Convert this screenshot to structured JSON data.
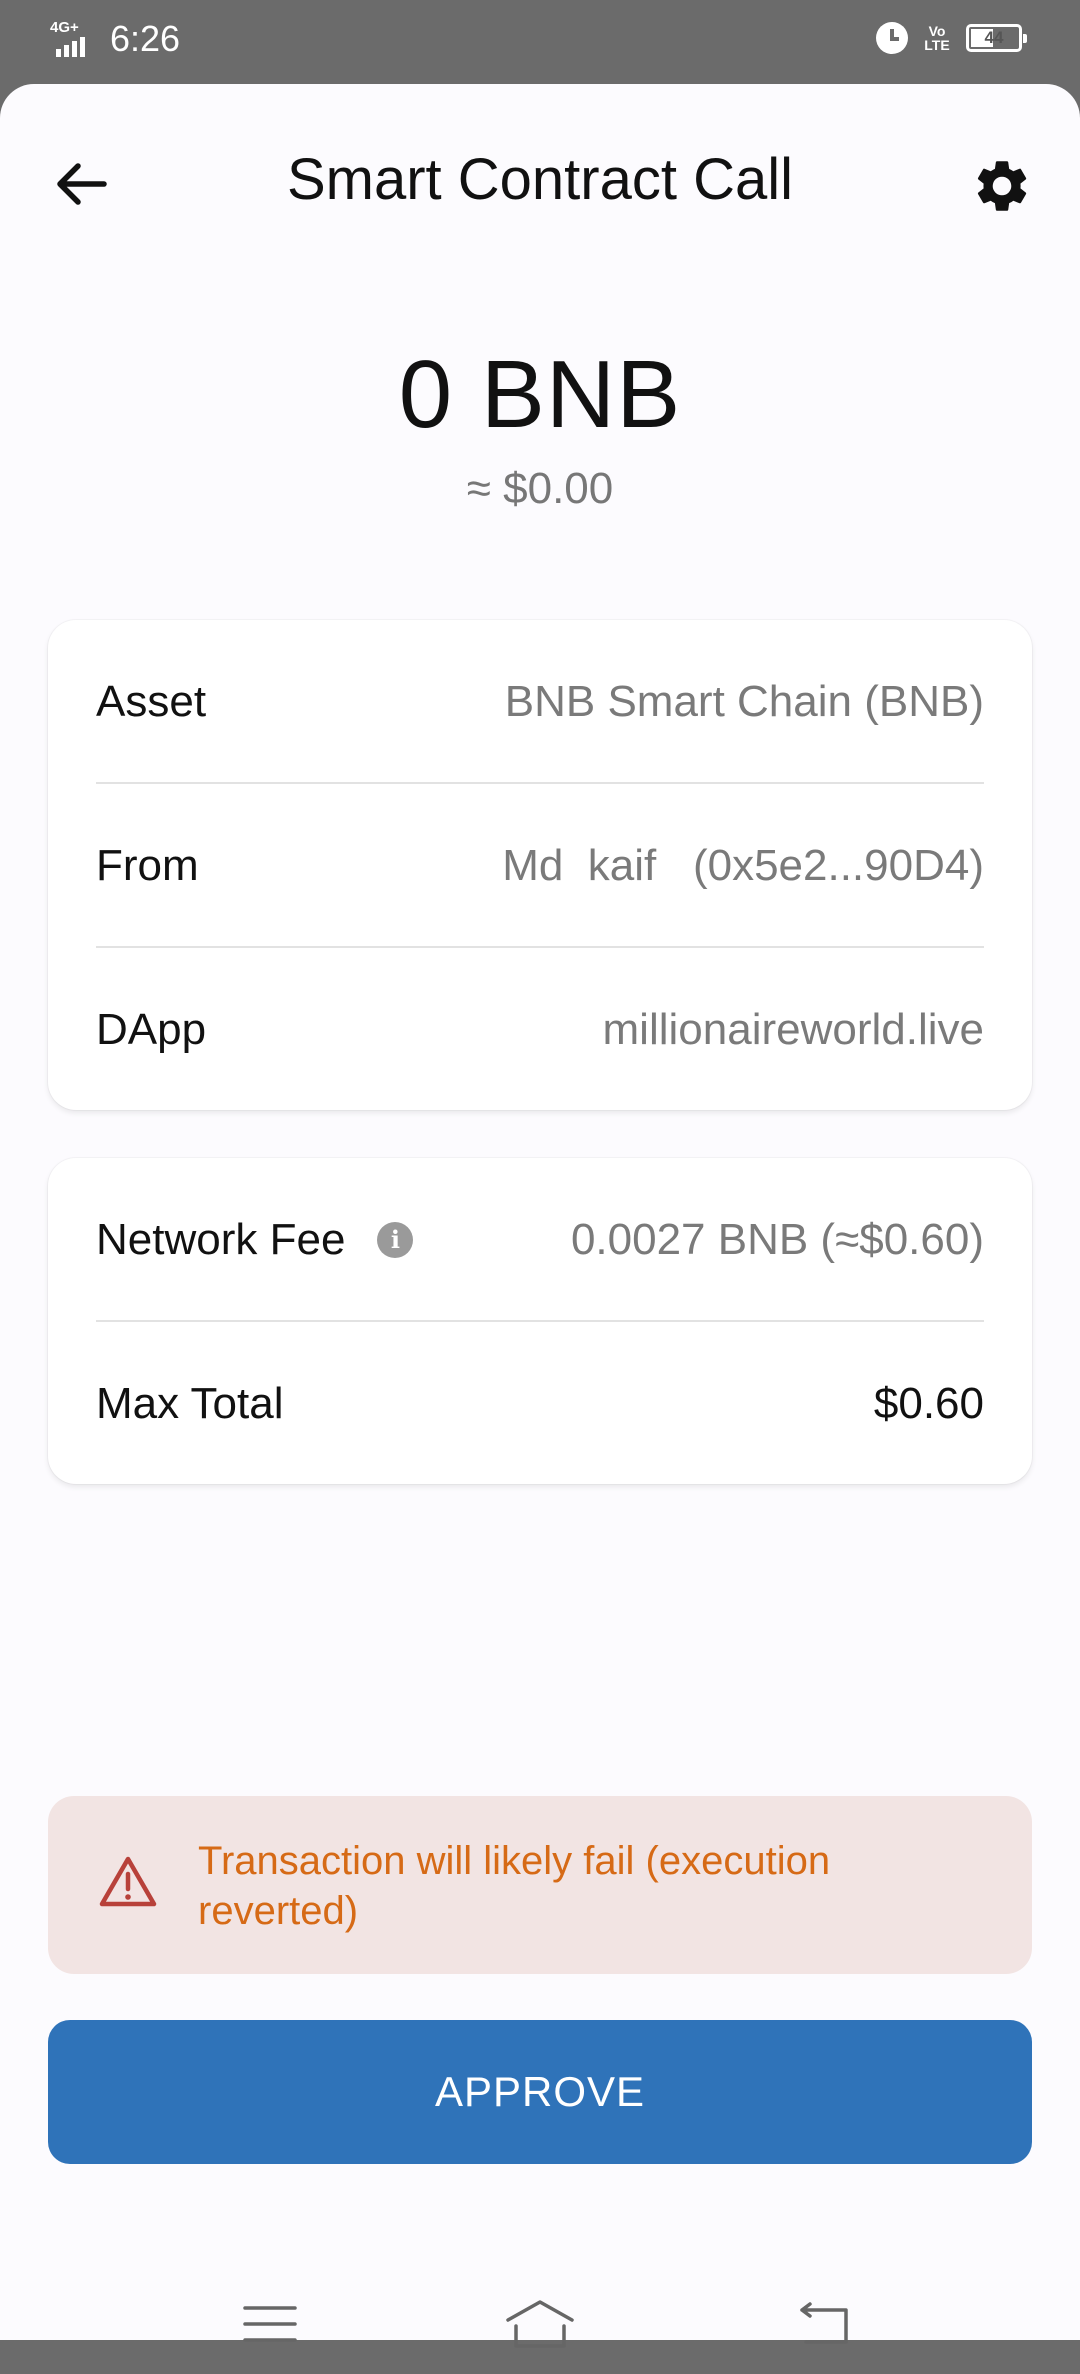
{
  "status_bar": {
    "network": "4G+",
    "time": "6:26",
    "volte": "Vo LTE",
    "battery": "44"
  },
  "header": {
    "title": "Smart Contract Call",
    "back_icon": "arrow-left-icon",
    "settings_icon": "gear-icon"
  },
  "amount": {
    "value": "0 BNB",
    "fiat": "≈ $0.00"
  },
  "details": [
    {
      "label": "Asset",
      "value": "BNB Smart Chain (BNB)"
    },
    {
      "label": "From",
      "value": "Md  kaif   (0x5e2...90D4)"
    },
    {
      "label": "DApp",
      "value": "millionaireworld.live"
    }
  ],
  "fees": {
    "network_fee_label": "Network Fee",
    "network_fee_value": "0.0027 BNB (≈$0.60)",
    "max_total_label": "Max Total",
    "max_total_value": "$0.60"
  },
  "warning": {
    "text": "Transaction will likely fail (execution reverted)",
    "icon": "warning-triangle-icon",
    "color": "#d66a16"
  },
  "approve": {
    "label": "APPROVE",
    "color": "#2f73b9"
  },
  "nav": {
    "menu_icon": "menu-icon",
    "home_icon": "home-icon",
    "back_icon": "back-icon"
  }
}
